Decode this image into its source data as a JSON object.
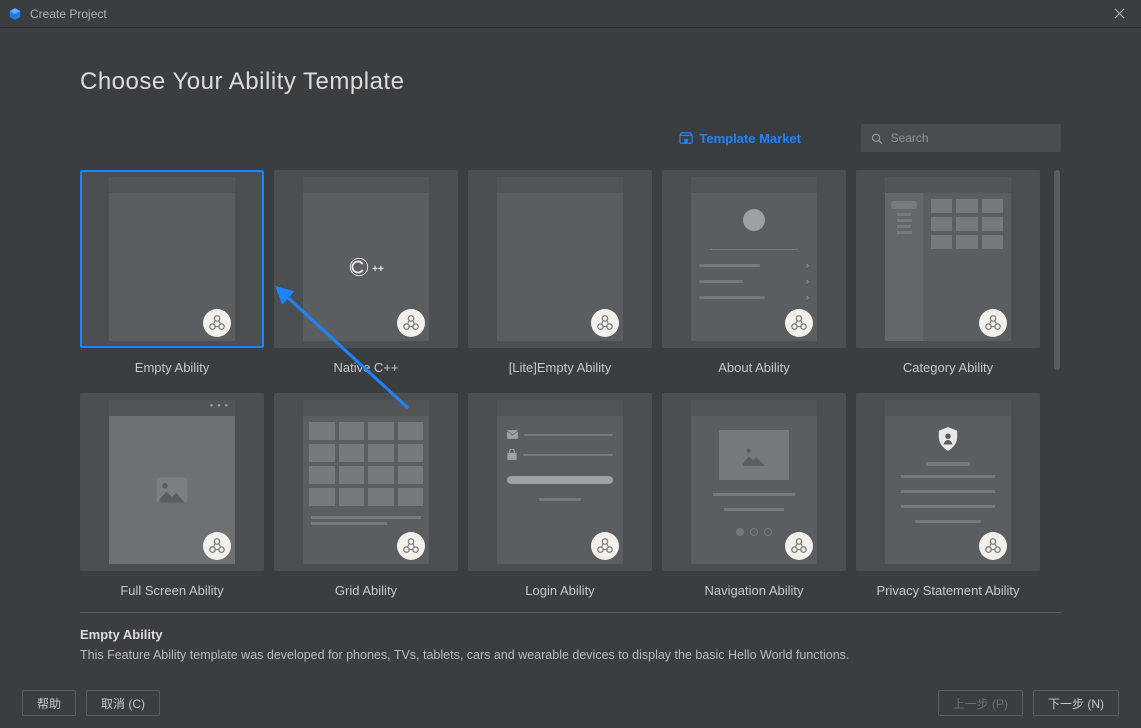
{
  "window": {
    "title": "Create Project"
  },
  "heading": "Choose Your Ability Template",
  "market_link": "Template Market",
  "search": {
    "placeholder": "Search"
  },
  "templates": [
    {
      "label": "Empty Ability",
      "selected": true
    },
    {
      "label": "Native C++"
    },
    {
      "label": "[Lite]Empty Ability"
    },
    {
      "label": "About Ability"
    },
    {
      "label": "Category Ability"
    },
    {
      "label": "Full Screen Ability"
    },
    {
      "label": "Grid Ability"
    },
    {
      "label": "Login Ability"
    },
    {
      "label": "Navigation Ability"
    },
    {
      "label": "Privacy Statement Ability"
    }
  ],
  "description": {
    "title": "Empty Ability",
    "text": "This Feature Ability template was developed for phones, TVs, tablets, cars and wearable devices to display the basic Hello World functions."
  },
  "buttons": {
    "help": "帮助",
    "cancel": "取消 (C)",
    "prev": "上一步 (P)",
    "next": "下一步 (N)"
  },
  "cpp_label": "C++"
}
